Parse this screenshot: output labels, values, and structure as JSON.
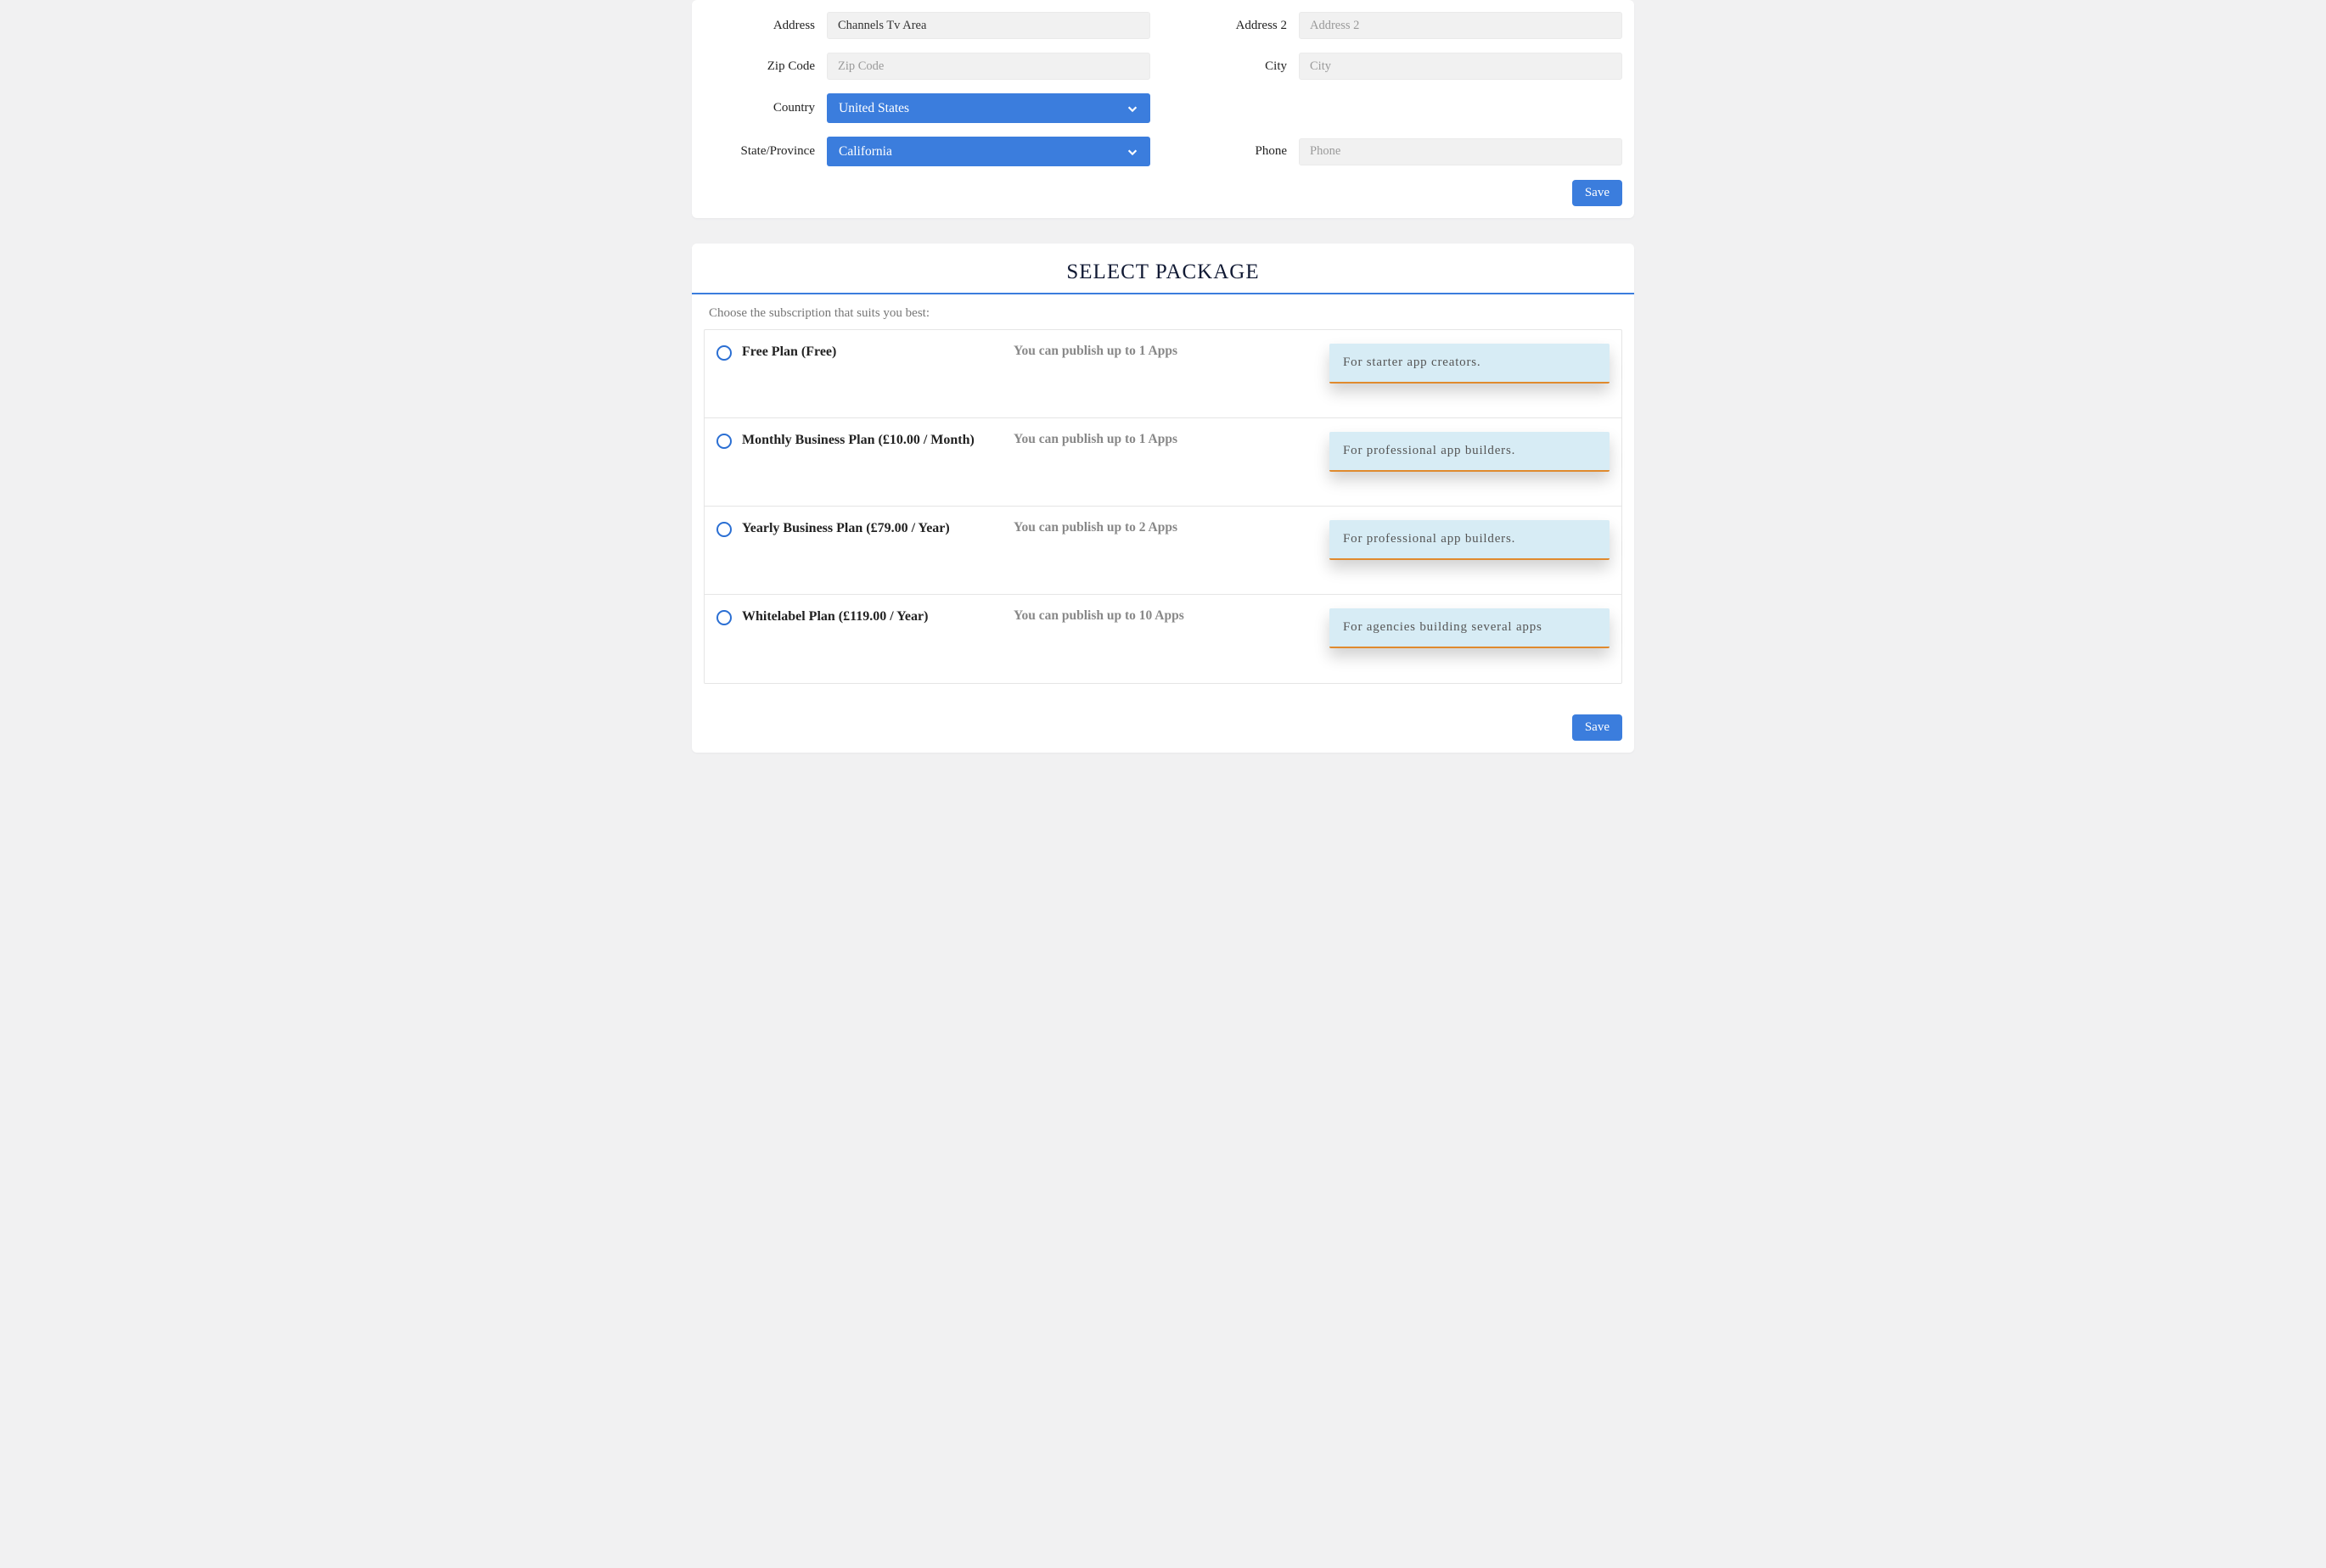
{
  "form": {
    "address": {
      "label": "Address",
      "value": "Channels Tv Area",
      "placeholder": "Address"
    },
    "address2": {
      "label": "Address 2",
      "value": "",
      "placeholder": "Address 2"
    },
    "zip": {
      "label": "Zip Code",
      "value": "",
      "placeholder": "Zip Code"
    },
    "city": {
      "label": "City",
      "value": "",
      "placeholder": "City"
    },
    "country": {
      "label": "Country",
      "value": "United States"
    },
    "state": {
      "label": "State/Province",
      "value": "California"
    },
    "phone": {
      "label": "Phone",
      "value": "",
      "placeholder": "Phone"
    },
    "save_label": "Save"
  },
  "package": {
    "title": "SELECT PACKAGE",
    "choose_text": "Choose the subscription that suits you best:",
    "plans": [
      {
        "name": "Free Plan (Free)",
        "desc": "You can publish up to 1 Apps",
        "tag": "For starter app creators."
      },
      {
        "name": "Monthly Business Plan (£10.00 / Month)",
        "desc": "You can publish up to 1 Apps",
        "tag": "For professional app builders."
      },
      {
        "name": "Yearly Business Plan (£79.00 / Year)",
        "desc": "You can publish up to 2 Apps",
        "tag": "For professional app builders."
      },
      {
        "name": "Whitelabel Plan (£119.00 / Year)",
        "desc": "You can publish up to 10 Apps",
        "tag": "For agencies building several apps"
      }
    ],
    "save_label": "Save"
  }
}
